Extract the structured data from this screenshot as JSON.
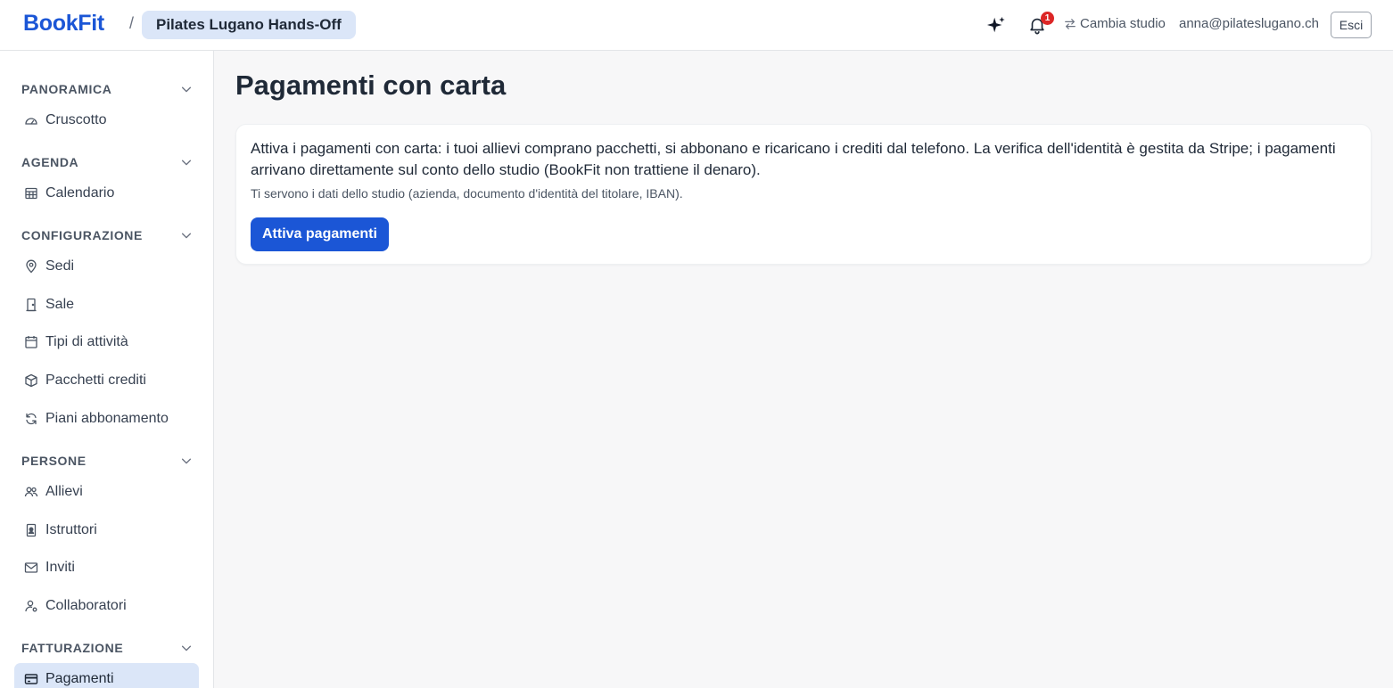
{
  "header": {
    "brand": "BookFit",
    "separator": "/",
    "studio_name": "Pilates Lugano Hands-Off",
    "notification_count": "1",
    "switch_studio_label": "Cambia studio",
    "user_email": "anna@pilateslugano.ch",
    "logout_label": "Esci"
  },
  "sidebar": {
    "sections": [
      {
        "title": "PANORAMICA",
        "items": [
          {
            "label": "Cruscotto",
            "icon": "dashboard-icon"
          }
        ]
      },
      {
        "title": "AGENDA",
        "items": [
          {
            "label": "Calendario",
            "icon": "calendar-grid-icon"
          }
        ]
      },
      {
        "title": "CONFIGURAZIONE",
        "items": [
          {
            "label": "Sedi",
            "icon": "map-pin-icon"
          },
          {
            "label": "Sale",
            "icon": "door-icon"
          },
          {
            "label": "Tipi di attività",
            "icon": "calendar-icon"
          },
          {
            "label": "Pacchetti crediti",
            "icon": "package-icon"
          },
          {
            "label": "Piani abbonamento",
            "icon": "refresh-icon"
          }
        ]
      },
      {
        "title": "PERSONE",
        "items": [
          {
            "label": "Allievi",
            "icon": "users-icon"
          },
          {
            "label": "Istruttori",
            "icon": "badge-icon"
          },
          {
            "label": "Inviti",
            "icon": "mail-icon"
          },
          {
            "label": "Collaboratori",
            "icon": "user-cog-icon"
          }
        ]
      },
      {
        "title": "FATTURAZIONE",
        "items": [
          {
            "label": "Pagamenti",
            "icon": "credit-card-icon",
            "active": true
          }
        ]
      }
    ]
  },
  "main": {
    "title": "Pagamenti con carta",
    "card": {
      "description": "Attiva i pagamenti con carta: i tuoi allievi comprano pacchetti, si abbonano e ricaricano i crediti dal telefono. La verifica dell'identità è gestita da Stripe; i pagamenti arrivano direttamente sul conto dello studio (BookFit non trattiene il denaro).",
      "hint": "Ti servono i dati dello studio (azienda, documento d'identità del titolare, IBAN).",
      "button_label": "Attiva pagamenti"
    }
  },
  "colors": {
    "accent": "#1b56d6",
    "active_bg": "#dbe6f8",
    "badge": "#dc2626"
  }
}
